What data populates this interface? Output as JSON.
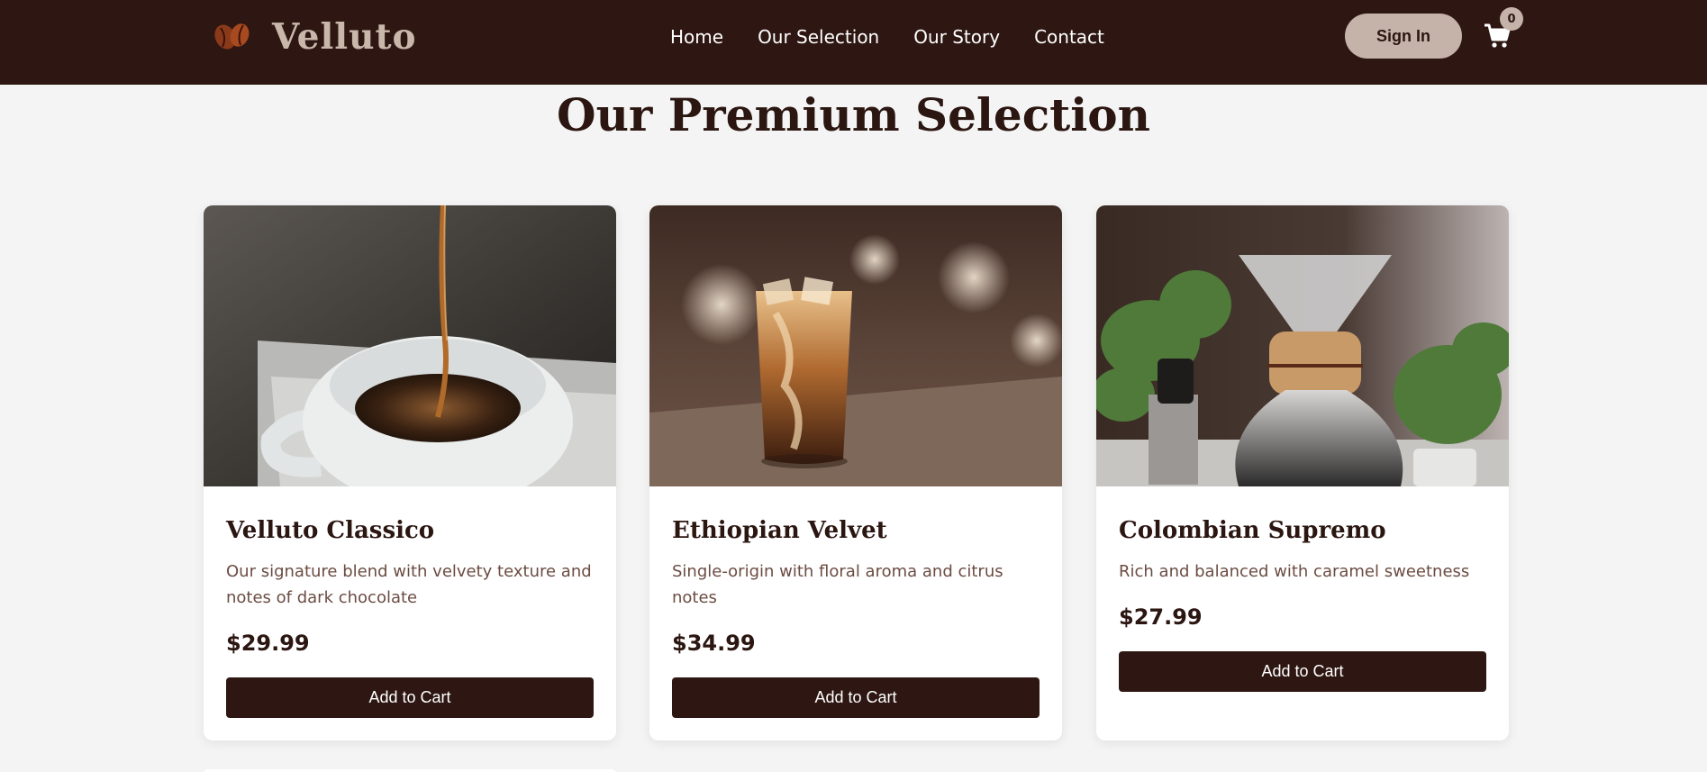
{
  "brand": {
    "name": "Velluto",
    "logo_icon": "coffee-beans-icon"
  },
  "nav": {
    "items": [
      {
        "label": "Home"
      },
      {
        "label": "Our Selection"
      },
      {
        "label": "Our Story"
      },
      {
        "label": "Contact"
      }
    ]
  },
  "header": {
    "sign_in_label": "Sign In",
    "cart_icon": "cart-icon",
    "cart_count": "0"
  },
  "main": {
    "title": "Our Premium Selection"
  },
  "products": [
    {
      "name": "Velluto Classico",
      "description": "Our signature blend with velvety texture and notes of dark chocolate",
      "price": "$29.99",
      "button_label": "Add to Cart",
      "image": "coffee pouring into a white cup"
    },
    {
      "name": "Ethiopian Velvet",
      "description": "Single-origin with floral aroma and citrus notes",
      "price": "$34.99",
      "button_label": "Add to Cart",
      "image": "iced coffee with cream in a tall glass"
    },
    {
      "name": "Colombian Supremo",
      "description": "Rich and balanced with caramel sweetness",
      "price": "$27.99",
      "button_label": "Add to Cart",
      "image": "pour-over coffee maker with grinder and plants"
    }
  ],
  "colors": {
    "header_bg": "#2e1712",
    "accent": "#c5b3aa",
    "page_bg": "#f4f4f4",
    "text_dark": "#2b1611",
    "text_muted": "#6b4c42"
  }
}
